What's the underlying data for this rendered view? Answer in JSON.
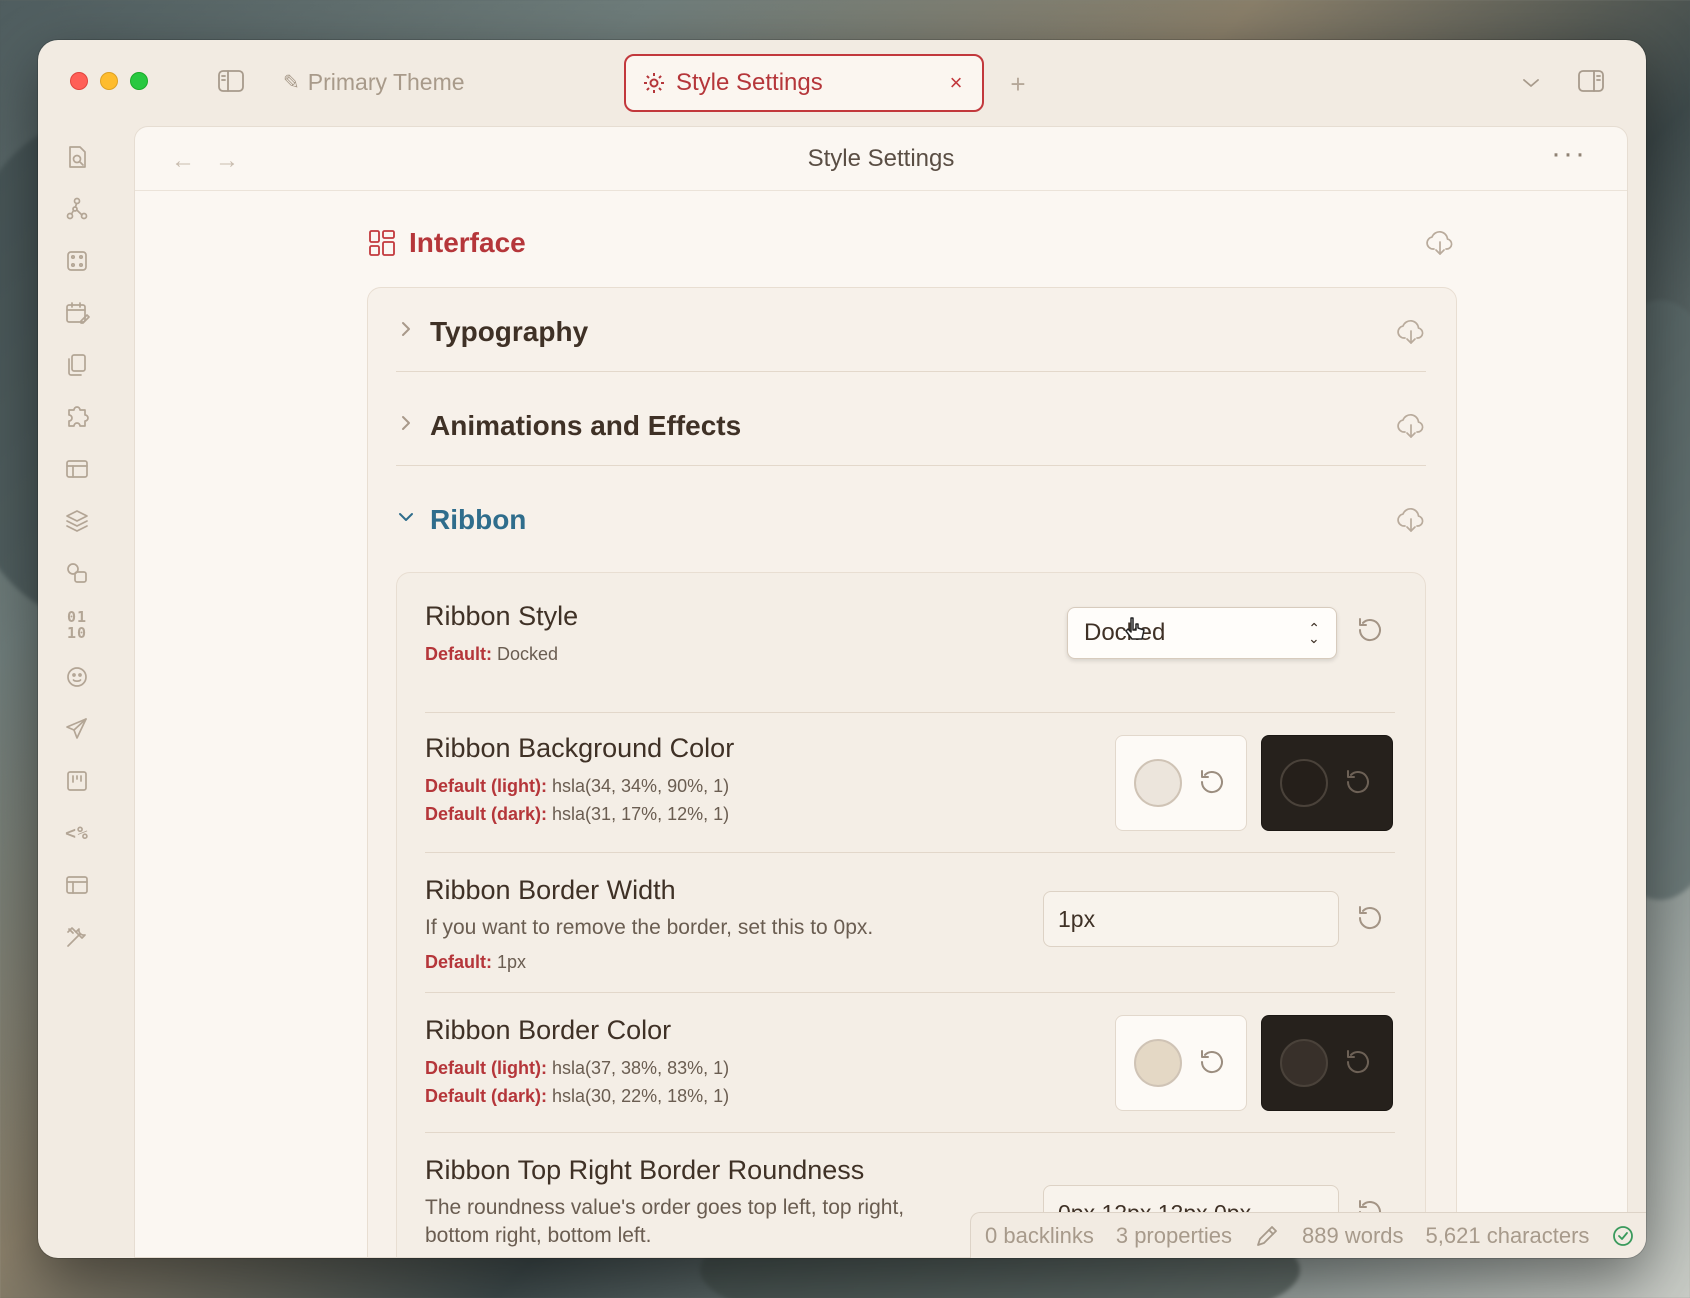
{
  "tabs": {
    "inactive_label": "Primary Theme",
    "active_label": "Style Settings",
    "close_symbol": "×",
    "add_symbol": "+"
  },
  "pane": {
    "title": "Style Settings",
    "back_symbol": "←",
    "forward_symbol": "→",
    "more_symbol": "···"
  },
  "ribbon": {
    "icons": [
      "search-file-icon",
      "graph-icon",
      "dice-icon",
      "calendar-edit-icon",
      "copy-icon",
      "puzzle-icon",
      "layout-icon",
      "layers-icon",
      "shapes-icon",
      "binary-icon",
      "face-icon",
      "send-icon",
      "kanban-icon",
      "template-icon",
      "layout-alt-icon",
      "tools-icon"
    ],
    "binary_text": "01\n10",
    "template_text": "<%"
  },
  "section": {
    "title": "Interface",
    "groups": [
      {
        "title": "Typography"
      },
      {
        "title": "Animations and Effects"
      },
      {
        "title": "Ribbon"
      }
    ]
  },
  "settings": {
    "ribbon_style": {
      "name": "Ribbon Style",
      "default_label": "Default:",
      "default_value": "Docked",
      "selected": "Docked"
    },
    "ribbon_bg": {
      "name": "Ribbon Background Color",
      "default_light_label": "Default (light):",
      "default_light_value": "hsla(34, 34%, 90%, 1)",
      "default_dark_label": "Default (dark):",
      "default_dark_value": "hsla(31, 17%, 12%, 1)",
      "light_color": "#ece5dc",
      "dark_color": "#251f1a"
    },
    "ribbon_border_width": {
      "name": "Ribbon Border Width",
      "desc": "If you want to remove the border, set this to 0px.",
      "default_label": "Default:",
      "default_value": "1px",
      "value": "1px"
    },
    "ribbon_border_color": {
      "name": "Ribbon Border Color",
      "default_light_label": "Default (light):",
      "default_light_value": "hsla(37, 38%, 83%, 1)",
      "default_dark_label": "Default (dark):",
      "default_dark_value": "hsla(30, 22%, 18%, 1)",
      "light_color": "#e4d8c5",
      "dark_color": "#38302a"
    },
    "ribbon_top_right": {
      "name": "Ribbon Top Right Border Roundness",
      "desc": "The roundness value's order goes top left, top right, bottom right, bottom left.",
      "value": "0px 12px 12px 0px"
    }
  },
  "status": {
    "backlinks": "0 backlinks",
    "properties": "3 properties",
    "words": "889 words",
    "characters": "5,621 characters"
  },
  "colors": {
    "accent": "#b5363a",
    "group_open": "#2f6d8c"
  }
}
